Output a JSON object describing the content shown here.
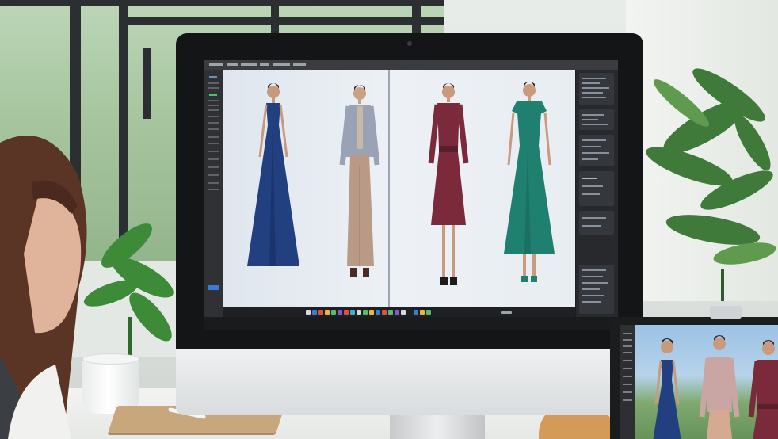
{
  "scene": {
    "description_tag": "",
    "colors": {
      "dress_navy": "#223f80",
      "jacket_tweed": "#9aa3b6",
      "dress_burgundy": "#7a2a3b",
      "dress_teal": "#1f8070",
      "desktop_ui_dark": "#2b2d30",
      "accent_blue": "#3a7bd5"
    }
  },
  "desktop_app": {
    "panels": [
      "left-toolbar",
      "canvas",
      "right-properties-panel",
      "taskbar"
    ]
  },
  "figures": {
    "monitor": [
      "navy-strapless-gown",
      "tweed-jacket-wide-trousers",
      "burgundy-wrap-dress",
      "teal-midi-dress"
    ],
    "tablet": [
      "navy-strapless-gown",
      "floral-jacket-outfit",
      "burgundy-wrap-dress"
    ]
  }
}
